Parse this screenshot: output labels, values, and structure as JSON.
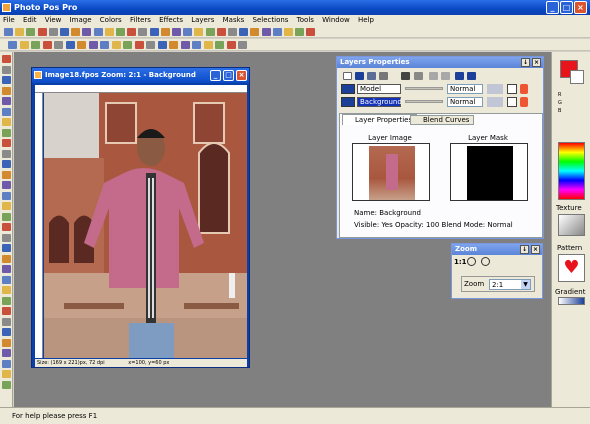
{
  "app": {
    "title": "Photo Pos Pro",
    "status": "For help please press F1"
  },
  "menu": [
    "File",
    "Edit",
    "View",
    "Image",
    "Colors",
    "Filters",
    "Effects",
    "Layers",
    "Masks",
    "Selections",
    "Tools",
    "Window",
    "Help"
  ],
  "image_window": {
    "title": "Image18.fpos  Zoom: 2:1 - Background",
    "status_size": "Size: (169 x 221)px, 72 dpi",
    "status_coords": "x=100, y=60 px"
  },
  "layers_panel": {
    "title": "Layers Properties",
    "layers": [
      {
        "name": "Model",
        "blend": "Normal",
        "selected": false
      },
      {
        "name": "Background",
        "blend": "Normal",
        "selected": true
      }
    ],
    "tabs": [
      "Layer Properties",
      "Blend Curves"
    ],
    "layer_image_label": "Layer Image",
    "layer_mask_label": "Layer Mask",
    "name_line": "Name:  Background",
    "info_line": "Visible: Yes   Opacity: 100   Blend Mode: Normal"
  },
  "zoom_panel": {
    "title": "Zoom",
    "ratio_label": "1:1",
    "zoom_label": "Zoom",
    "zoom_value": "2:1"
  },
  "right_panel": {
    "texture_label": "Texture",
    "pattern_label": "Pattern",
    "gradient_label": "Gradient"
  },
  "colors": {
    "foreground": "#e8141c",
    "title_blue": "#0a49c4",
    "panel_title": "#6b91df"
  }
}
